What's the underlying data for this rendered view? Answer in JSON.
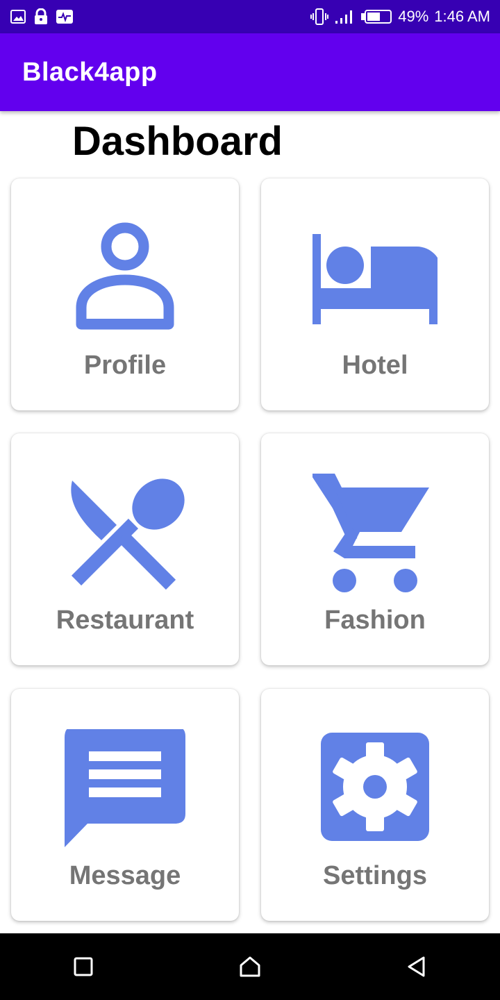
{
  "status_bar": {
    "icons_left": [
      "image-icon",
      "lock-icon",
      "activity-icon"
    ],
    "icons_right": [
      "vibrate-icon",
      "signal-icon",
      "battery-icon"
    ],
    "battery": "49%",
    "time": "1:46 AM"
  },
  "app_bar": {
    "title": "Black4app",
    "color": "#6200ee"
  },
  "page": {
    "title": "Dashboard"
  },
  "cards": [
    {
      "label": "Profile",
      "icon": "person-icon"
    },
    {
      "label": "Hotel",
      "icon": "bed-icon"
    },
    {
      "label": "Restaurant",
      "icon": "restaurant-icon"
    },
    {
      "label": "Fashion",
      "icon": "shopping-cart-icon"
    },
    {
      "label": "Message",
      "icon": "message-icon"
    },
    {
      "label": "Settings",
      "icon": "settings-icon"
    }
  ],
  "icon_color": "#6181e6",
  "nav_bar": {
    "buttons": [
      "recents-button",
      "home-button",
      "back-button"
    ]
  }
}
